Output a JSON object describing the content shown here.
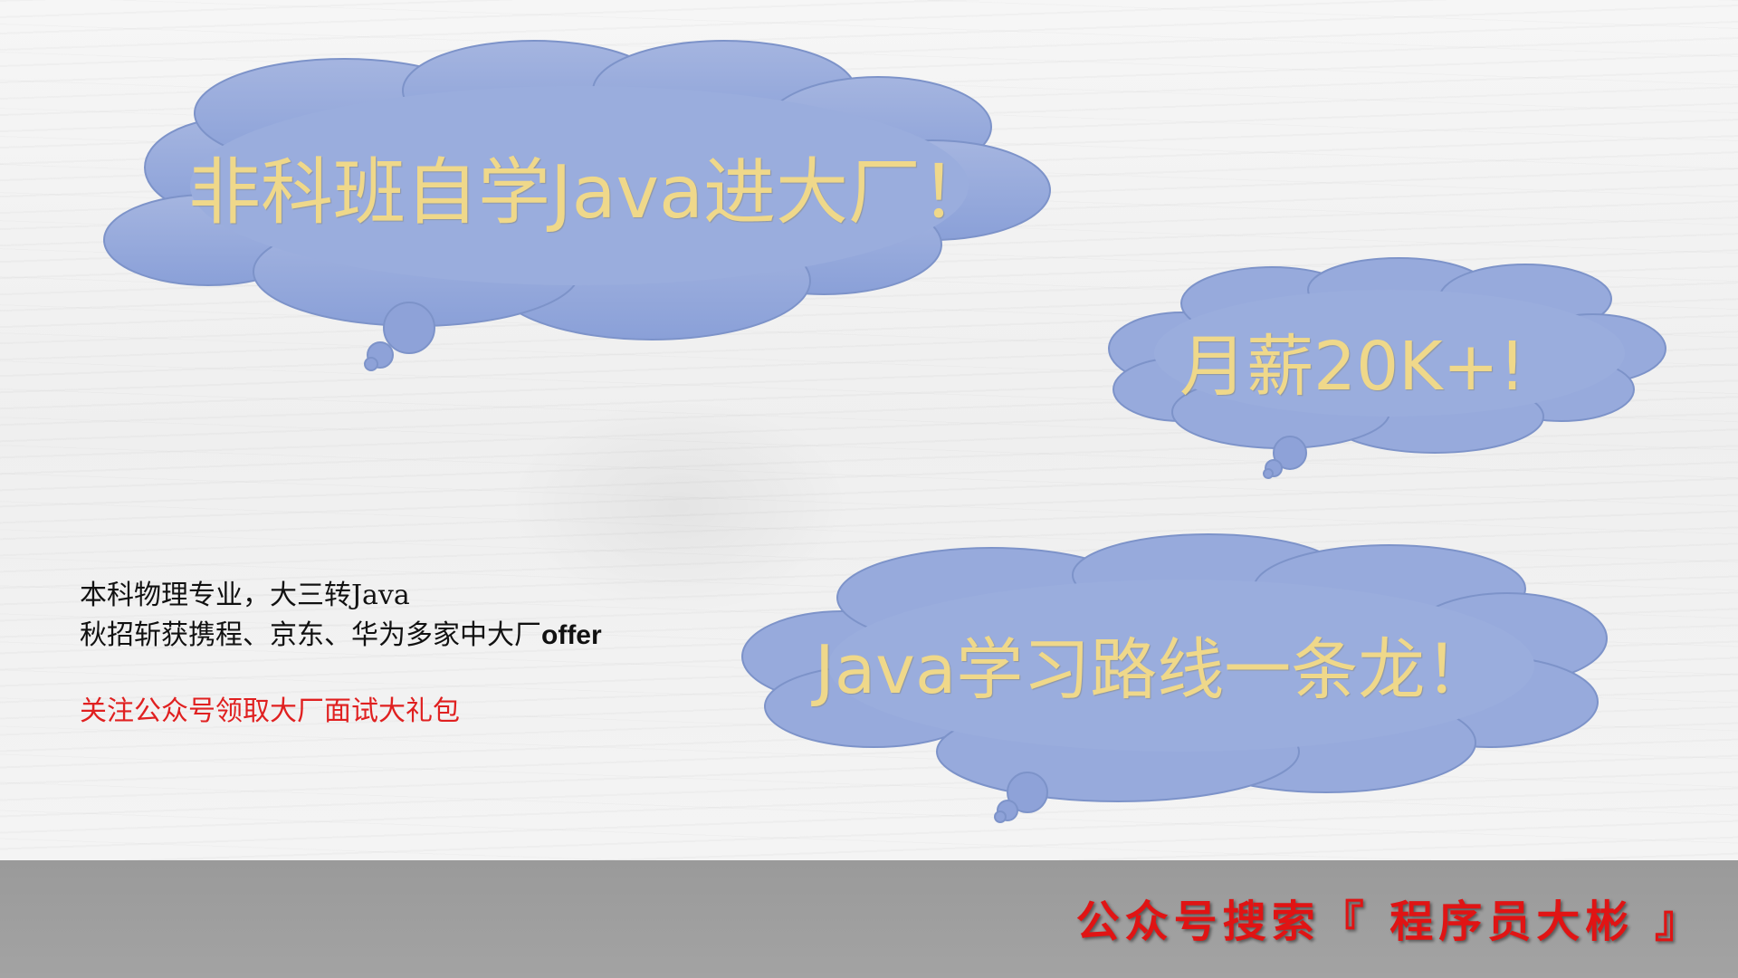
{
  "clouds": {
    "main": "非科班自学Java进大厂！",
    "salary": "月薪20K+!",
    "roadmap": "Java学习路线一条龙！"
  },
  "info": {
    "line1": "本科物理专业，大三转Java",
    "line2_prefix": "秋招斩获携程、京东、华为多家中大厂",
    "line2_suffix": "offer",
    "follow": "关注公众号领取大厂面试大礼包"
  },
  "bottom_bar": {
    "text": "公众号搜索『 程序员大彬 』"
  },
  "colors": {
    "cloud_fill": "#95a9dc",
    "cloud_text": "#efd88a",
    "red_text": "#e02020",
    "bar": "#a0a0a0"
  }
}
